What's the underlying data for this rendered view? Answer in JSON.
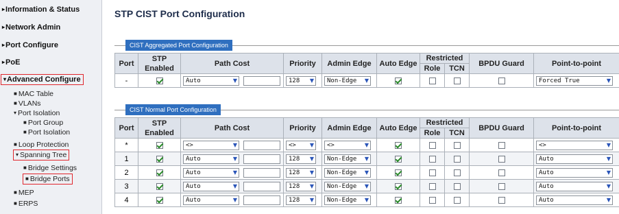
{
  "sidebar": {
    "items": [
      {
        "label": "Information & Status",
        "arrow": "▸"
      },
      {
        "label": "Network Admin",
        "arrow": "▸"
      },
      {
        "label": "Port Configure",
        "arrow": "▸"
      },
      {
        "label": "PoE",
        "arrow": "▸"
      },
      {
        "label": "Advanced Configure",
        "arrow": "▾"
      }
    ],
    "sub": {
      "mac_table": "MAC Table",
      "vlans": "VLANs",
      "port_isolation": "Port Isolation",
      "port_group": "Port Group",
      "port_isolation_child": "Port Isolation",
      "loop_protection": "Loop Protection",
      "spanning_tree": "Spanning Tree",
      "bridge_settings": "Bridge Settings",
      "bridge_ports": "Bridge Ports",
      "mep": "MEP",
      "erps": "ERPS"
    },
    "highlight_color": "#e0252b"
  },
  "page": {
    "title": "STP CIST Port Configuration"
  },
  "headers": {
    "port": "Port",
    "stp_enabled": "STP Enabled",
    "path_cost": "Path Cost",
    "priority": "Priority",
    "admin_edge": "Admin Edge",
    "auto_edge": "Auto Edge",
    "restricted": "Restricted",
    "role": "Role",
    "tcn": "TCN",
    "bpdu_guard": "BPDU Guard",
    "point_to_point": "Point-to-point"
  },
  "aggregated": {
    "section_label": "CIST Aggregated Port Configuration",
    "row": {
      "port": "-",
      "stp_enabled": true,
      "path_cost": "Auto",
      "priority": "128",
      "admin_edge": "Non-Edge",
      "auto_edge": true,
      "role": false,
      "tcn": false,
      "bpdu_guard": false,
      "point_to_point": "Forced True"
    }
  },
  "normal": {
    "section_label": "CIST Normal Port Configuration",
    "rows": [
      {
        "port": "*",
        "stp_enabled": true,
        "path_cost": "<>",
        "priority": "<>",
        "admin_edge": "<>",
        "auto_edge": true,
        "role": false,
        "tcn": false,
        "bpdu_guard": false,
        "point_to_point": "<>"
      },
      {
        "port": "1",
        "stp_enabled": true,
        "path_cost": "Auto",
        "priority": "128",
        "admin_edge": "Non-Edge",
        "auto_edge": true,
        "role": false,
        "tcn": false,
        "bpdu_guard": false,
        "point_to_point": "Auto"
      },
      {
        "port": "2",
        "stp_enabled": true,
        "path_cost": "Auto",
        "priority": "128",
        "admin_edge": "Non-Edge",
        "auto_edge": true,
        "role": false,
        "tcn": false,
        "bpdu_guard": false,
        "point_to_point": "Auto"
      },
      {
        "port": "3",
        "stp_enabled": true,
        "path_cost": "Auto",
        "priority": "128",
        "admin_edge": "Non-Edge",
        "auto_edge": true,
        "role": false,
        "tcn": false,
        "bpdu_guard": false,
        "point_to_point": "Auto"
      },
      {
        "port": "4",
        "stp_enabled": true,
        "path_cost": "Auto",
        "priority": "128",
        "admin_edge": "Non-Edge",
        "auto_edge": true,
        "role": false,
        "tcn": false,
        "bpdu_guard": false,
        "point_to_point": "Auto"
      }
    ]
  },
  "icons": {
    "dropdown": "chevron-down-icon",
    "checkbox_checked": "check-icon"
  },
  "colors": {
    "section_label_bg": "#2f6fbf",
    "title": "#1d2c4a",
    "header_bg": "#dde2ea"
  }
}
